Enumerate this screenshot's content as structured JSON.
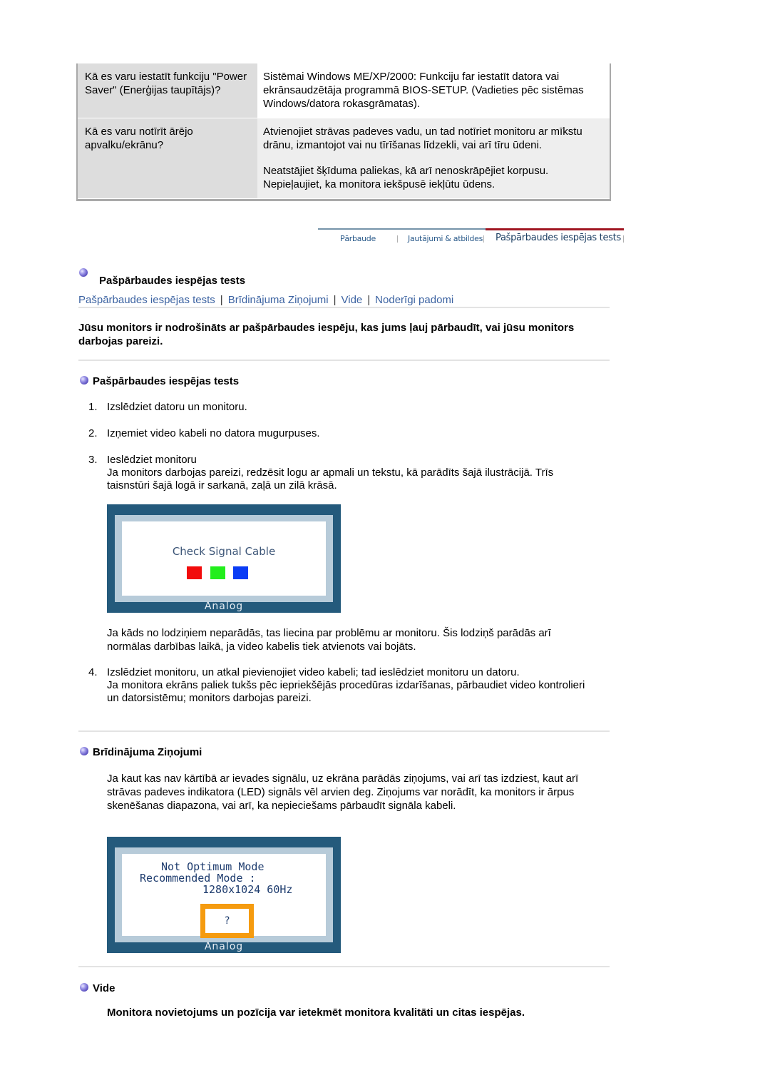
{
  "faq": [
    {
      "question": "Kā es varu iestatīt funkciju \"Power Saver\" (Enerģijas taupītājs)?",
      "answers": [
        "Sistēmai Windows ME/XP/2000: Funkciju far iestatīt datora vai ekrānsaudzētāja programmā BIOS-SETUP. (Vadieties pēc sistēmas Windows/datora rokasgrāmatas)."
      ]
    },
    {
      "question": "Kā es varu notīrīt ārējo apvalku/ekrānu?",
      "answers": [
        "Atvienojiet strāvas padeves vadu, un tad notīriet monitoru ar mīkstu drānu, izmantojot vai nu tīrīšanas līdzekli, vai arī tīru ūdeni.",
        "Neatstājiet šķīduma paliekas, kā arī nenoskrāpējiet korpusu. Nepieļaujiet, ka monitora iekšpusē iekļūtu ūdens."
      ]
    }
  ],
  "tabs": [
    {
      "label": "Pārbaude",
      "active": false
    },
    {
      "label": "Jautājumi & atbildes",
      "active": false
    },
    {
      "label": "Pašpārbaudes iespējas tests",
      "active": true
    }
  ],
  "page": {
    "title": "Pašpārbaudes iespējas tests",
    "bullet_icon": "purple-sphere-bullet",
    "subnav": [
      "Pašpārbaudes iespējas tests",
      "Brīdinājuma Ziņojumi",
      "Vide",
      "Noderīgi padomi"
    ],
    "subnav_separator": "|",
    "intro": "Jūsu monitors ir nodrošināts ar pašpārbaudes iespēju, kas jums ļauj pārbaudīt, vai jūsu monitors darbojas pareizi."
  },
  "selftest": {
    "heading": "Pašpārbaudes iespējas tests",
    "steps": [
      {
        "num": "1.",
        "text": "Izslēdziet datoru un monitoru.",
        "extra": ""
      },
      {
        "num": "2.",
        "text": "Izņemiet video kabeli no datora mugurpuses.",
        "extra": ""
      },
      {
        "num": "3.",
        "text": "Ieslēdziet monitoru",
        "extra": "Ja monitors darbojas pareizi, redzēsit logu ar apmali un tekstu, kā parādīts šajā ilustrācijā. Trīs taisnstūri šajā logā ir sarkanā, zaļā un zilā krāsā."
      },
      {
        "num": "4.",
        "text": "Izslēdziet monitoru, un atkal pievienojiet video kabeli; tad ieslēdziet monitoru un datoru.",
        "extra": "Ja monitora ekrāns paliek tukšs pēc iepriekšējās procedūras izdarīšanas, pārbaudiet video kontrolieri un datorsistēmu; monitors darbojas pareizi."
      }
    ],
    "note": "Ja kāds no lodziņiem neparādās, tas liecina par problēmu ar monitoru. Šis lodziņš parādās arī normālas darbības laikā, ja video kabelis tiek atvienots vai bojāts.",
    "illustration": {
      "message": "Check Signal Cable",
      "squares": [
        "#f20c0c",
        "#22ee1c",
        "#0a3cf5"
      ],
      "footer": "Analog"
    }
  },
  "warnings": {
    "heading": "Brīdinājuma Ziņojumi",
    "text": "Ja kaut kas nav kārtībā ar ievades signālu, uz ekrāna parādās ziņojums, vai arī tas izdziest, kaut arī strāvas padeves indikatora (LED) signāls vēl arvien deg. Ziņojums var norādīt, ka monitors ir ārpus skenēšanas diapazona, vai arī, ka nepieciešams pārbaudīt signāla kabeli.",
    "illustration": {
      "line1": "Not Optimum Mode",
      "line2": "Recommended Mode :",
      "line3": "1280x1024 60Hz",
      "box": "?",
      "footer": "Analog"
    }
  },
  "environment": {
    "heading": "Vide",
    "text": "Monitora novietojums un pozīcija var ietekmēt monitora kvalitāti un citas iespējas."
  },
  "colors": {
    "link": "#3c63a2",
    "tab_active_underline": "#a01622",
    "monitor_frame": "#245a7c",
    "highlight_box": "#f59b0f"
  }
}
